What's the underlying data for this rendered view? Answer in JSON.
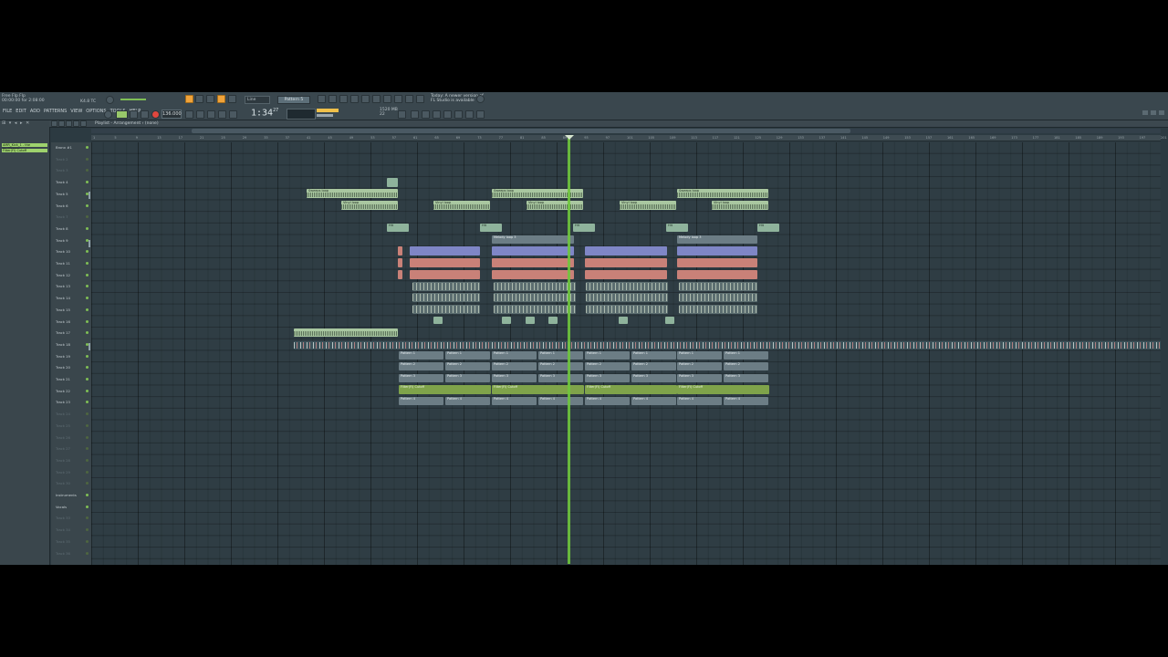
{
  "topbar": {
    "song_line1": "Free Flp Flp",
    "song_line2": "00:00:00 for 2:08:00",
    "mode": "K4.8 TC",
    "menu": [
      "FILE",
      "EDIT",
      "ADD",
      "PATTERNS",
      "VIEW",
      "OPTIONS",
      "TOOLS",
      "HELP"
    ],
    "tempo": "136.000",
    "time": "1:34",
    "time_sub": "27",
    "cpu_line1": "1520 MB",
    "cpu_line2": "22",
    "pattern": "Pattern 5",
    "line_mode": "Line",
    "hint_line1": "Today: A newer version of",
    "hint_line2": "FL Studio is available"
  },
  "browser": {
    "items": [
      {
        "label": "AMR_Kick_1 - the multisamp",
        "color": "#9ed26d"
      },
      {
        "label": "Filter(Fl) Cutoff",
        "color": "#9ed26d"
      }
    ]
  },
  "playlist": {
    "title": "Playlist - Arrangement › (none)",
    "ruler": [
      "1",
      "5",
      "9",
      "13",
      "17",
      "21",
      "25",
      "29",
      "33",
      "37",
      "41",
      "45",
      "49",
      "53",
      "57",
      "61",
      "65",
      "69",
      "73",
      "77",
      "81",
      "85",
      "89",
      "93",
      "97",
      "101",
      "105",
      "109",
      "113",
      "117",
      "121",
      "125",
      "129",
      "133",
      "137",
      "141",
      "145",
      "149",
      "153",
      "157",
      "161",
      "165",
      "169",
      "173",
      "177",
      "181",
      "185",
      "189",
      "193",
      "197",
      "201"
    ],
    "tracks": [
      {
        "label": "Bronx #1",
        "active": true
      },
      {
        "label": "Track 2",
        "active": false
      },
      {
        "label": "Track 3",
        "active": false
      },
      {
        "label": "Track 4",
        "active": true
      },
      {
        "label": "Track 5",
        "active": true
      },
      {
        "label": "Track 6",
        "active": true
      },
      {
        "label": "Track 7",
        "active": false
      },
      {
        "label": "Track 8",
        "active": true
      },
      {
        "label": "Track 9",
        "active": true
      },
      {
        "label": "Track 10",
        "active": true
      },
      {
        "label": "Track 11",
        "active": true
      },
      {
        "label": "Track 12",
        "active": true
      },
      {
        "label": "Track 13",
        "active": true
      },
      {
        "label": "Track 14",
        "active": true
      },
      {
        "label": "Track 15",
        "active": true
      },
      {
        "label": "Track 16",
        "active": true
      },
      {
        "label": "Track 17",
        "active": true
      },
      {
        "label": "Track 18",
        "active": true
      },
      {
        "label": "Track 19",
        "active": true
      },
      {
        "label": "Track 20",
        "active": true
      },
      {
        "label": "Track 21",
        "active": true
      },
      {
        "label": "Track 22",
        "active": true
      },
      {
        "label": "Track 23",
        "active": true
      },
      {
        "label": "Track 24",
        "active": false
      },
      {
        "label": "Track 25",
        "active": false
      },
      {
        "label": "Track 26",
        "active": false
      },
      {
        "label": "Track 27",
        "active": false
      },
      {
        "label": "Track 28",
        "active": false
      },
      {
        "label": "Track 29",
        "active": false
      },
      {
        "label": "Track 30",
        "active": false
      },
      {
        "label": "Instruments",
        "active": true
      },
      {
        "label": "Vocals",
        "active": true
      },
      {
        "label": "Track 33",
        "active": false
      },
      {
        "label": "Track 34",
        "active": false
      },
      {
        "label": "Track 35",
        "active": false
      },
      {
        "label": "Track 36",
        "active": false
      }
    ],
    "clip_labels": {
      "sweep": "Sweeps loop",
      "vinyl": "Vinyl loop",
      "hit": "Hit",
      "melody": "Melody loop 3",
      "pattern1": "Pattern 1",
      "pattern2": "Pattern 2",
      "pattern3": "Pattern 3",
      "pattern4": "Pattern 4",
      "auto": "Filter(Fl) Cutoff"
    }
  }
}
